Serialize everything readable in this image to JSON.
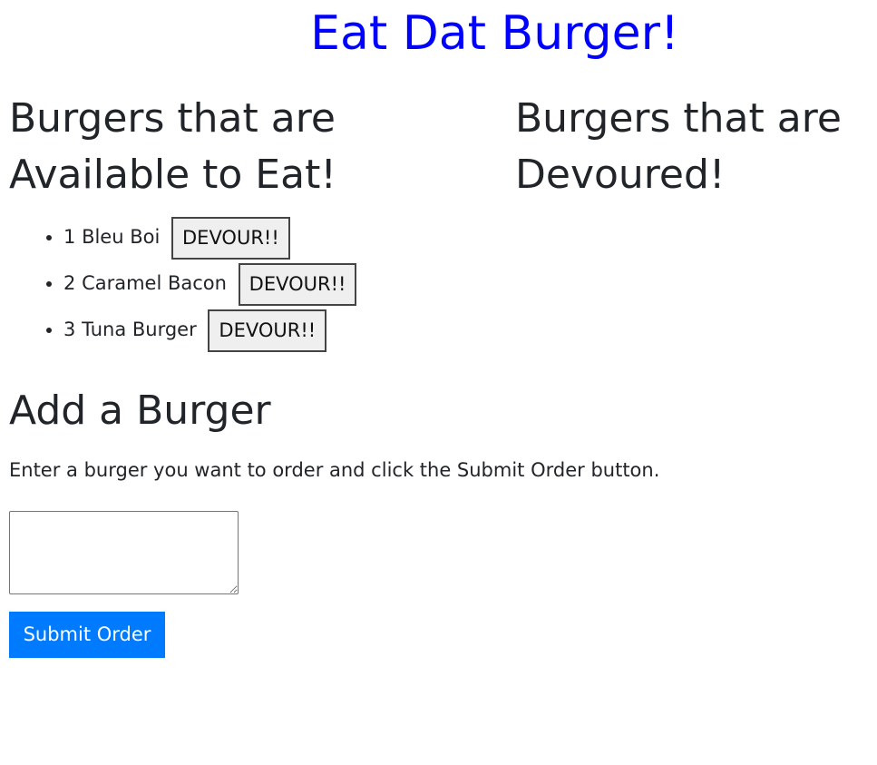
{
  "header": {
    "title": "Eat Dat Burger!"
  },
  "available": {
    "heading": "Burgers that are Available to Eat!",
    "items": [
      {
        "id": "1",
        "name": "Bleu Boi",
        "button_label": "DEVOUR!!"
      },
      {
        "id": "2",
        "name": "Caramel Bacon",
        "button_label": "DEVOUR!!"
      },
      {
        "id": "3",
        "name": "Tuna Burger",
        "button_label": "DEVOUR!!"
      }
    ]
  },
  "devoured": {
    "heading": "Burgers that are Devoured!",
    "items": []
  },
  "add_form": {
    "heading": "Add a Burger",
    "instructions": "Enter a burger you want to order and click the Submit Order button.",
    "input_value": "",
    "submit_label": "Submit Order"
  },
  "colors": {
    "title": "#0000ff",
    "submit_button": "#007bff"
  }
}
